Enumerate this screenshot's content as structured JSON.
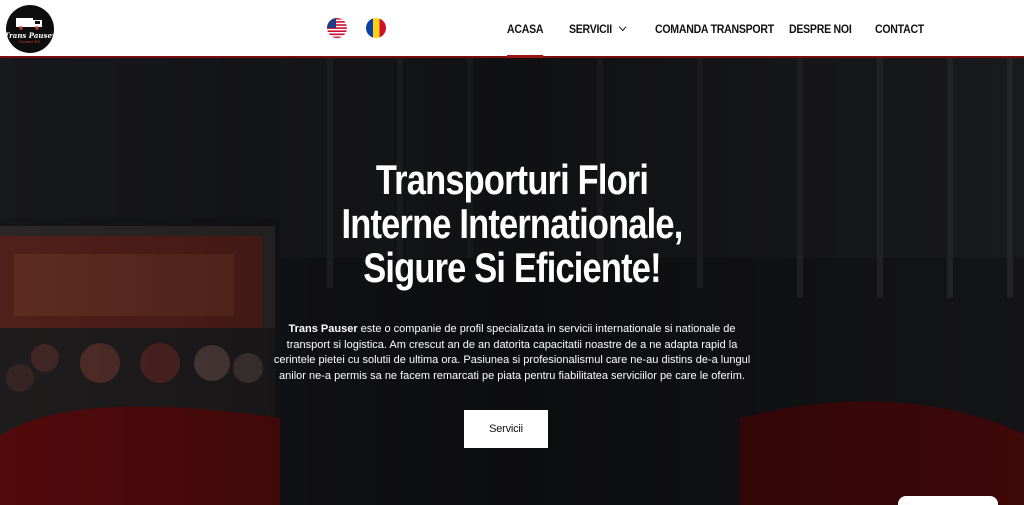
{
  "header": {
    "logo": {
      "title": "Trans Pauser",
      "subtitle": "Romania SRL"
    },
    "languages": [
      {
        "name": "us-flag-icon",
        "lang": "English"
      },
      {
        "name": "ro-flag-icon",
        "lang": "Romana"
      }
    ],
    "nav": [
      {
        "label": "ACASA",
        "active": true
      },
      {
        "label": "SERVICII",
        "has_dropdown": true
      },
      {
        "label": "COMANDA TRANSPORT"
      },
      {
        "label": "DESPRE NOI"
      },
      {
        "label": "CONTACT"
      }
    ]
  },
  "hero": {
    "title_lines": [
      "Transporturi Flori",
      "Interne Internationale,",
      "Sigure Si Eficiente!"
    ],
    "desc_bold": "Trans Pauser",
    "desc_rest": " este o companie de profil specializata in servicii internationale si nationale de transport si logistica. Am crescut an de an datorita capacitatii noastre de a ne adapta rapid la cerintele pietei cu solutii de ultima ora. Pasiunea si profesionalismul care ne-au distins de-a lungul anilor ne-a permis sa ne facem remarcati pe piata pentru fiabilitatea serviciilor pe care le oferim.",
    "button_label": "Servicii"
  },
  "colors": {
    "accent": "#9b1414",
    "header_bg": "#ffffff",
    "hero_overlay": "#1a1b20"
  }
}
